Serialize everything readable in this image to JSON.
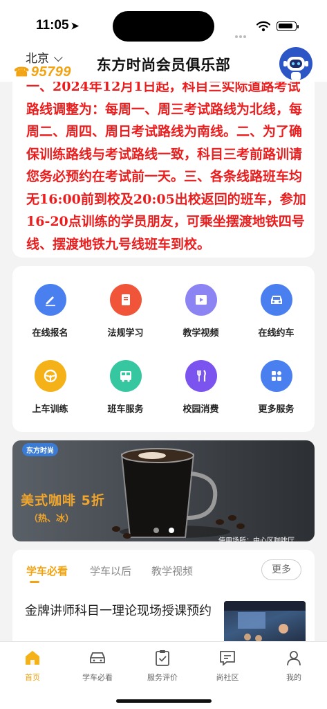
{
  "status_bar": {
    "time": "11:05",
    "location_icon": "location-arrow-icon",
    "signal_icon": "signal-dots-icon",
    "wifi_icon": "wifi-icon",
    "battery_icon": "battery-icon"
  },
  "header": {
    "city": "北京",
    "city_icon": "chevron-down-icon",
    "phone": "95799",
    "phone_icon": "phone-icon",
    "title": "东方时尚会员俱乐部",
    "assistant_icon": "robot-avatar-icon"
  },
  "notice": {
    "text": "一、2024年12月1日起，科目三实际道路考试路线调整为：每周一、周三考试路线为北线，每周二、周四、周日考试路线为南线。二、为了确保训练路线与考试路线一致，科目三考前路训请您务必预约在考试前一天。三、各条线路班车均无16:00前到校及20:05出校返回的班车，参加16-20点训练的学员朋友，可乘坐摆渡地铁四号线、摆渡地铁九号线班车到校。",
    "color": "#ea1e1e"
  },
  "services": [
    {
      "label": "在线报名",
      "icon": "pencil-icon",
      "color": "#4a7ff0"
    },
    {
      "label": "法规学习",
      "icon": "book-icon",
      "color": "#f0553a"
    },
    {
      "label": "教学视频",
      "icon": "video-icon",
      "color": "#8c84f2"
    },
    {
      "label": "在线约车",
      "icon": "car-icon",
      "color": "#4a7ff0"
    },
    {
      "label": "上车训练",
      "icon": "steering-wheel-icon",
      "color": "#f5b118"
    },
    {
      "label": "班车服务",
      "icon": "bus-icon",
      "color": "#37c7a0"
    },
    {
      "label": "校园消费",
      "icon": "fork-knife-icon",
      "color": "#7b54ef"
    },
    {
      "label": "更多服务",
      "icon": "grid-icon",
      "color": "#4a7ff0"
    }
  ],
  "banner": {
    "logo": "东方时尚",
    "title": "美式咖啡  5折",
    "subtitle": "（热、冰）",
    "footer": "使用场所：中心区咖啡厅"
  },
  "news": {
    "tabs": [
      "学车必看",
      "学车以后",
      "教学视频"
    ],
    "active_tab": "学车必看",
    "more": "更多",
    "article_title": "金牌讲师科目一理论现场授课预约"
  },
  "tabbar": [
    {
      "label": "首页",
      "icon": "home-icon",
      "active": true
    },
    {
      "label": "学车必看",
      "icon": "car-outline-icon",
      "active": false
    },
    {
      "label": "服务评价",
      "icon": "clipboard-check-icon",
      "active": false
    },
    {
      "label": "尚社区",
      "icon": "chat-bubble-icon",
      "active": false
    },
    {
      "label": "我的",
      "icon": "user-icon",
      "active": false
    }
  ],
  "colors": {
    "accent": "#f2a311",
    "notice_red": "#ea1e1e"
  }
}
